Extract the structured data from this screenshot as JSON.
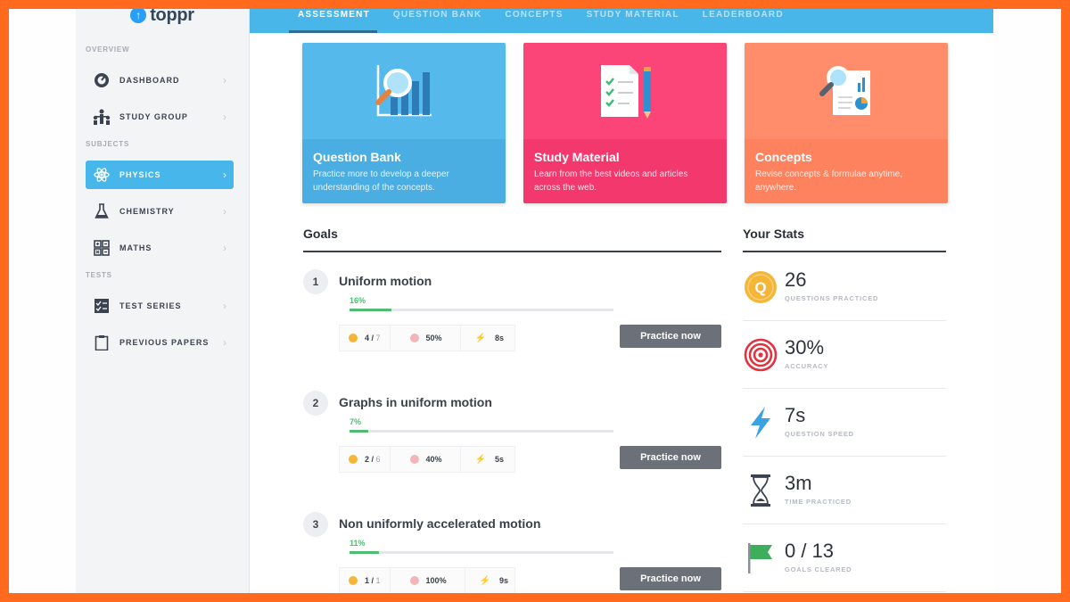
{
  "app": {
    "brand": "toppr"
  },
  "sidebar": {
    "sections": {
      "overview": "OVERVIEW",
      "subjects": "SUBJECTS",
      "tests": "TESTS"
    },
    "items": [
      {
        "label": "DASHBOARD",
        "icon": "dashboard-icon",
        "active": false
      },
      {
        "label": "STUDY GROUP",
        "icon": "study-group-icon",
        "active": false
      },
      {
        "label": "PHYSICS",
        "icon": "atom-icon",
        "active": true
      },
      {
        "label": "CHEMISTRY",
        "icon": "flask-icon",
        "active": false
      },
      {
        "label": "MATHS",
        "icon": "maths-icon",
        "active": false
      },
      {
        "label": "TEST SERIES",
        "icon": "test-series-icon",
        "active": false
      },
      {
        "label": "PREVIOUS PAPERS",
        "icon": "clipboard-icon",
        "active": false
      }
    ]
  },
  "tabs": [
    {
      "label": "ASSESSMENT",
      "active": true
    },
    {
      "label": "QUESTION BANK",
      "active": false
    },
    {
      "label": "CONCEPTS",
      "active": false
    },
    {
      "label": "STUDY MATERIAL",
      "active": false
    },
    {
      "label": "LEADERBOARD",
      "active": false
    }
  ],
  "cards": [
    {
      "title": "Question Bank",
      "desc": "Practice more to develop a deeper understanding of the concepts.",
      "color": "#55b9ec",
      "text_bg": "#4aaee3"
    },
    {
      "title": "Study Material",
      "desc": "Learn from the best videos and articles across the web.",
      "color": "#fb4477",
      "text_bg": "#f2386c"
    },
    {
      "title": "Concepts",
      "desc": "Revise concepts & formulae anytime, anywhere.",
      "color": "#ff8d6c",
      "text_bg": "#ff825f"
    }
  ],
  "goals": {
    "heading": "Goals",
    "items": [
      {
        "num": "1",
        "name": "Uniform motion",
        "pct": "16%",
        "progress": 0.16,
        "correct": "4",
        "total": "7",
        "accuracy": "50%",
        "speed": "8s",
        "button": "Practice now"
      },
      {
        "num": "2",
        "name": "Graphs in uniform motion",
        "pct": "7%",
        "progress": 0.07,
        "correct": "2",
        "total": "6",
        "accuracy": "40%",
        "speed": "5s",
        "button": "Practice now"
      },
      {
        "num": "3",
        "name": "Non uniformly accelerated motion",
        "pct": "11%",
        "progress": 0.11,
        "correct": "1",
        "total": "1",
        "accuracy": "100%",
        "speed": "9s",
        "button": "Practice now"
      }
    ]
  },
  "stats": {
    "heading": "Your Stats",
    "items": [
      {
        "value": "26",
        "caption": "QUESTIONS PRACTICED",
        "icon": "questions-icon"
      },
      {
        "value": "30%",
        "caption": "ACCURACY",
        "icon": "target-icon"
      },
      {
        "value": "7s",
        "caption": "QUESTION SPEED",
        "icon": "lightning-icon"
      },
      {
        "value": "3m",
        "caption": "TIME PRACTICED",
        "icon": "hourglass-icon"
      },
      {
        "value": "0 / 13",
        "caption": "GOALS CLEARED",
        "icon": "flag-icon"
      }
    ]
  },
  "colors": {
    "accent": "#49b6ea",
    "progress": "#4fbb73",
    "frame": "#ff6a1f"
  }
}
